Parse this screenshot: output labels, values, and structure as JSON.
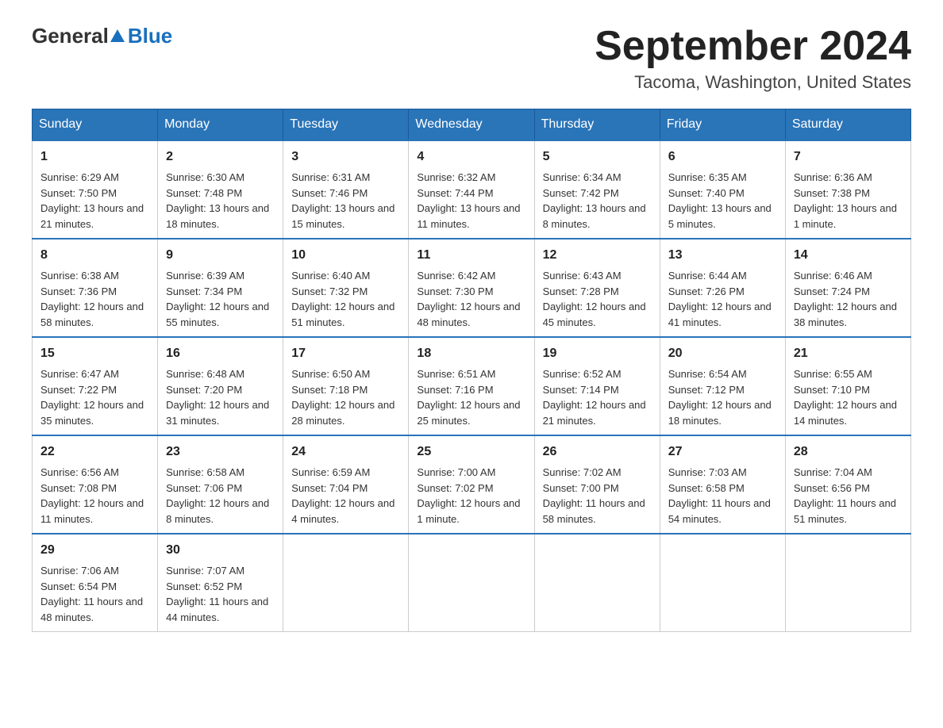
{
  "header": {
    "logo_general": "General",
    "logo_blue": "Blue",
    "month_title": "September 2024",
    "location": "Tacoma, Washington, United States"
  },
  "weekdays": [
    "Sunday",
    "Monday",
    "Tuesday",
    "Wednesday",
    "Thursday",
    "Friday",
    "Saturday"
  ],
  "weeks": [
    [
      {
        "day": "1",
        "sunrise": "Sunrise: 6:29 AM",
        "sunset": "Sunset: 7:50 PM",
        "daylight": "Daylight: 13 hours and 21 minutes."
      },
      {
        "day": "2",
        "sunrise": "Sunrise: 6:30 AM",
        "sunset": "Sunset: 7:48 PM",
        "daylight": "Daylight: 13 hours and 18 minutes."
      },
      {
        "day": "3",
        "sunrise": "Sunrise: 6:31 AM",
        "sunset": "Sunset: 7:46 PM",
        "daylight": "Daylight: 13 hours and 15 minutes."
      },
      {
        "day": "4",
        "sunrise": "Sunrise: 6:32 AM",
        "sunset": "Sunset: 7:44 PM",
        "daylight": "Daylight: 13 hours and 11 minutes."
      },
      {
        "day": "5",
        "sunrise": "Sunrise: 6:34 AM",
        "sunset": "Sunset: 7:42 PM",
        "daylight": "Daylight: 13 hours and 8 minutes."
      },
      {
        "day": "6",
        "sunrise": "Sunrise: 6:35 AM",
        "sunset": "Sunset: 7:40 PM",
        "daylight": "Daylight: 13 hours and 5 minutes."
      },
      {
        "day": "7",
        "sunrise": "Sunrise: 6:36 AM",
        "sunset": "Sunset: 7:38 PM",
        "daylight": "Daylight: 13 hours and 1 minute."
      }
    ],
    [
      {
        "day": "8",
        "sunrise": "Sunrise: 6:38 AM",
        "sunset": "Sunset: 7:36 PM",
        "daylight": "Daylight: 12 hours and 58 minutes."
      },
      {
        "day": "9",
        "sunrise": "Sunrise: 6:39 AM",
        "sunset": "Sunset: 7:34 PM",
        "daylight": "Daylight: 12 hours and 55 minutes."
      },
      {
        "day": "10",
        "sunrise": "Sunrise: 6:40 AM",
        "sunset": "Sunset: 7:32 PM",
        "daylight": "Daylight: 12 hours and 51 minutes."
      },
      {
        "day": "11",
        "sunrise": "Sunrise: 6:42 AM",
        "sunset": "Sunset: 7:30 PM",
        "daylight": "Daylight: 12 hours and 48 minutes."
      },
      {
        "day": "12",
        "sunrise": "Sunrise: 6:43 AM",
        "sunset": "Sunset: 7:28 PM",
        "daylight": "Daylight: 12 hours and 45 minutes."
      },
      {
        "day": "13",
        "sunrise": "Sunrise: 6:44 AM",
        "sunset": "Sunset: 7:26 PM",
        "daylight": "Daylight: 12 hours and 41 minutes."
      },
      {
        "day": "14",
        "sunrise": "Sunrise: 6:46 AM",
        "sunset": "Sunset: 7:24 PM",
        "daylight": "Daylight: 12 hours and 38 minutes."
      }
    ],
    [
      {
        "day": "15",
        "sunrise": "Sunrise: 6:47 AM",
        "sunset": "Sunset: 7:22 PM",
        "daylight": "Daylight: 12 hours and 35 minutes."
      },
      {
        "day": "16",
        "sunrise": "Sunrise: 6:48 AM",
        "sunset": "Sunset: 7:20 PM",
        "daylight": "Daylight: 12 hours and 31 minutes."
      },
      {
        "day": "17",
        "sunrise": "Sunrise: 6:50 AM",
        "sunset": "Sunset: 7:18 PM",
        "daylight": "Daylight: 12 hours and 28 minutes."
      },
      {
        "day": "18",
        "sunrise": "Sunrise: 6:51 AM",
        "sunset": "Sunset: 7:16 PM",
        "daylight": "Daylight: 12 hours and 25 minutes."
      },
      {
        "day": "19",
        "sunrise": "Sunrise: 6:52 AM",
        "sunset": "Sunset: 7:14 PM",
        "daylight": "Daylight: 12 hours and 21 minutes."
      },
      {
        "day": "20",
        "sunrise": "Sunrise: 6:54 AM",
        "sunset": "Sunset: 7:12 PM",
        "daylight": "Daylight: 12 hours and 18 minutes."
      },
      {
        "day": "21",
        "sunrise": "Sunrise: 6:55 AM",
        "sunset": "Sunset: 7:10 PM",
        "daylight": "Daylight: 12 hours and 14 minutes."
      }
    ],
    [
      {
        "day": "22",
        "sunrise": "Sunrise: 6:56 AM",
        "sunset": "Sunset: 7:08 PM",
        "daylight": "Daylight: 12 hours and 11 minutes."
      },
      {
        "day": "23",
        "sunrise": "Sunrise: 6:58 AM",
        "sunset": "Sunset: 7:06 PM",
        "daylight": "Daylight: 12 hours and 8 minutes."
      },
      {
        "day": "24",
        "sunrise": "Sunrise: 6:59 AM",
        "sunset": "Sunset: 7:04 PM",
        "daylight": "Daylight: 12 hours and 4 minutes."
      },
      {
        "day": "25",
        "sunrise": "Sunrise: 7:00 AM",
        "sunset": "Sunset: 7:02 PM",
        "daylight": "Daylight: 12 hours and 1 minute."
      },
      {
        "day": "26",
        "sunrise": "Sunrise: 7:02 AM",
        "sunset": "Sunset: 7:00 PM",
        "daylight": "Daylight: 11 hours and 58 minutes."
      },
      {
        "day": "27",
        "sunrise": "Sunrise: 7:03 AM",
        "sunset": "Sunset: 6:58 PM",
        "daylight": "Daylight: 11 hours and 54 minutes."
      },
      {
        "day": "28",
        "sunrise": "Sunrise: 7:04 AM",
        "sunset": "Sunset: 6:56 PM",
        "daylight": "Daylight: 11 hours and 51 minutes."
      }
    ],
    [
      {
        "day": "29",
        "sunrise": "Sunrise: 7:06 AM",
        "sunset": "Sunset: 6:54 PM",
        "daylight": "Daylight: 11 hours and 48 minutes."
      },
      {
        "day": "30",
        "sunrise": "Sunrise: 7:07 AM",
        "sunset": "Sunset: 6:52 PM",
        "daylight": "Daylight: 11 hours and 44 minutes."
      },
      null,
      null,
      null,
      null,
      null
    ]
  ]
}
